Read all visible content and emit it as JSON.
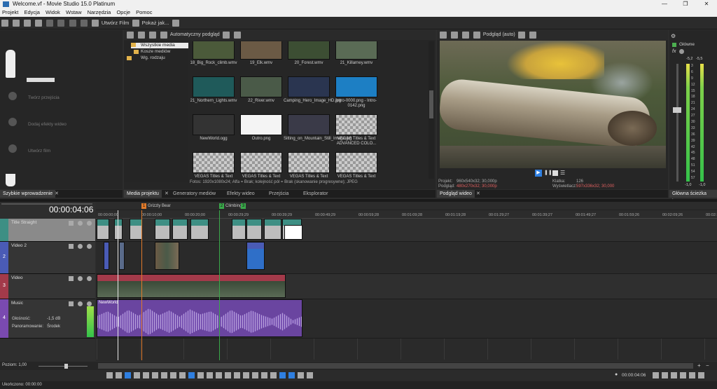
{
  "window": {
    "title": "Welcome.vf - Movie Studio 15.0 Platinum"
  },
  "menu": [
    "Projekt",
    "Edycja",
    "Widok",
    "Wstaw",
    "Narzędzia",
    "Opcje",
    "Pomoc"
  ],
  "toolbar": {
    "create_movie": "Utwórz Film",
    "show_how": "Pokaż jak..."
  },
  "quickstart": {
    "steps": [
      "Twórz przejścia",
      "Dodaj efekty wideo",
      "Utwórz film"
    ],
    "tab": "Szybkie wprowadzenie"
  },
  "media": {
    "auto_preview": "Automatyczny podgląd",
    "tree": [
      "Wszystkie media",
      "Kosze mediów",
      "Wg. rodzaju"
    ],
    "items": [
      {
        "name": "18_Big_Rock_climb.wmv",
        "color": "#4b5a3a"
      },
      {
        "name": "19_Elk.wmv",
        "color": "#6b5a45"
      },
      {
        "name": "20_Forest.wmv",
        "color": "#3c4e33"
      },
      {
        "name": "21_Killarney.wmv",
        "color": "#5a6b55"
      },
      {
        "name": "21_Northern_Lights.wmv",
        "color": "#1f5a5a"
      },
      {
        "name": "22_River.wmv",
        "color": "#4a5a48"
      },
      {
        "name": "Camping_Hero_Image_HD.jpg",
        "color": "#2a3550"
      },
      {
        "name": "Intro-0000.png - Intro-0142.png",
        "color": "#1d7fc4"
      },
      {
        "name": "NewWorld.ogg",
        "color": "#333333"
      },
      {
        "name": "Outro.png",
        "color": "#f4f4f4"
      },
      {
        "name": "Sitting_on_Mountain_Still_Image.jpg",
        "color": "#3a3a48"
      },
      {
        "name": "VEGAS Titles & Text ADVANCED COLO...",
        "color": "checker"
      },
      {
        "name": "VEGAS Titles & Text",
        "color": "checker"
      },
      {
        "name": "VEGAS Titles & Text",
        "color": "checker"
      },
      {
        "name": "VEGAS Titles & Text",
        "color": "checker"
      },
      {
        "name": "VEGAS Titles & Text",
        "color": "checker"
      }
    ],
    "status": "Fotos: 1920x1080x24; Alfa = Brak; kolejność pól = Brak (skanowanie progresywne); JPEG",
    "tabs": [
      "Media projektu",
      "Generatory mediów",
      "Efekty wideo",
      "Przejścia",
      "Eksplorator"
    ]
  },
  "preview": {
    "mode": "Podgląd (auto)",
    "project_label": "Projekt:",
    "project_value": "960x540x32; 30,000p",
    "preview_label": "Podgląd:",
    "preview_value": "480x270x32; 30,000p",
    "frame_label": "Klatka:",
    "frame_value": "126",
    "display_label": "Wyświetlacz:",
    "display_value": "597x336x32; 30,000",
    "tab": "Podgląd wideo"
  },
  "master": {
    "label": "Główne",
    "db_left": "-5,2",
    "db_right": "-5,5",
    "scale": [
      "3",
      "6",
      "9",
      "12",
      "15",
      "18",
      "21",
      "24",
      "27",
      "30",
      "33",
      "36",
      "39",
      "42",
      "45",
      "48",
      "51",
      "54",
      "57"
    ],
    "bottom_left": "-1,0",
    "bottom_right": "-1,0",
    "tab": "Główna ścieżka bus"
  },
  "timeline": {
    "timecode": "00:00:04:06",
    "markers": [
      {
        "num": "1",
        "label": "Grizzly Bear"
      },
      {
        "num": "2",
        "label": "Climbing"
      },
      {
        "num": "3",
        "label": ""
      }
    ],
    "ruler": [
      "00:00:00;00",
      "00:00:10;00",
      "00:00:20;00",
      "00:00:29;29",
      "00:00:39;29",
      "00:00:49;29",
      "00:00:59;28",
      "00:01:09;28",
      "00:01:19;28",
      "00:01:29;27",
      "00:01:39;27",
      "00:01:49;27",
      "00:01:59;26",
      "00:02:09;26",
      "00:02:19;26"
    ],
    "tracks": [
      {
        "num": "",
        "name": "Title Straight",
        "color": "#3e8f84"
      },
      {
        "num": "2",
        "name": "Video 2",
        "color": "#4a5bb5"
      },
      {
        "num": "3",
        "name": "Video",
        "color": "#a33a4a"
      },
      {
        "num": "4",
        "name": "Music",
        "color": "#7a4ab0"
      }
    ],
    "volume_label": "Głośność:",
    "volume_value": "-1,5 dB",
    "pan_label": "Panoramowanie:",
    "pan_value": "Środek",
    "music_clip": "NewWorld",
    "zoom_label": "Poziom: 1,00",
    "status": "Ukończono: 00:00:00",
    "cursor_time": "00:00:04:06"
  }
}
